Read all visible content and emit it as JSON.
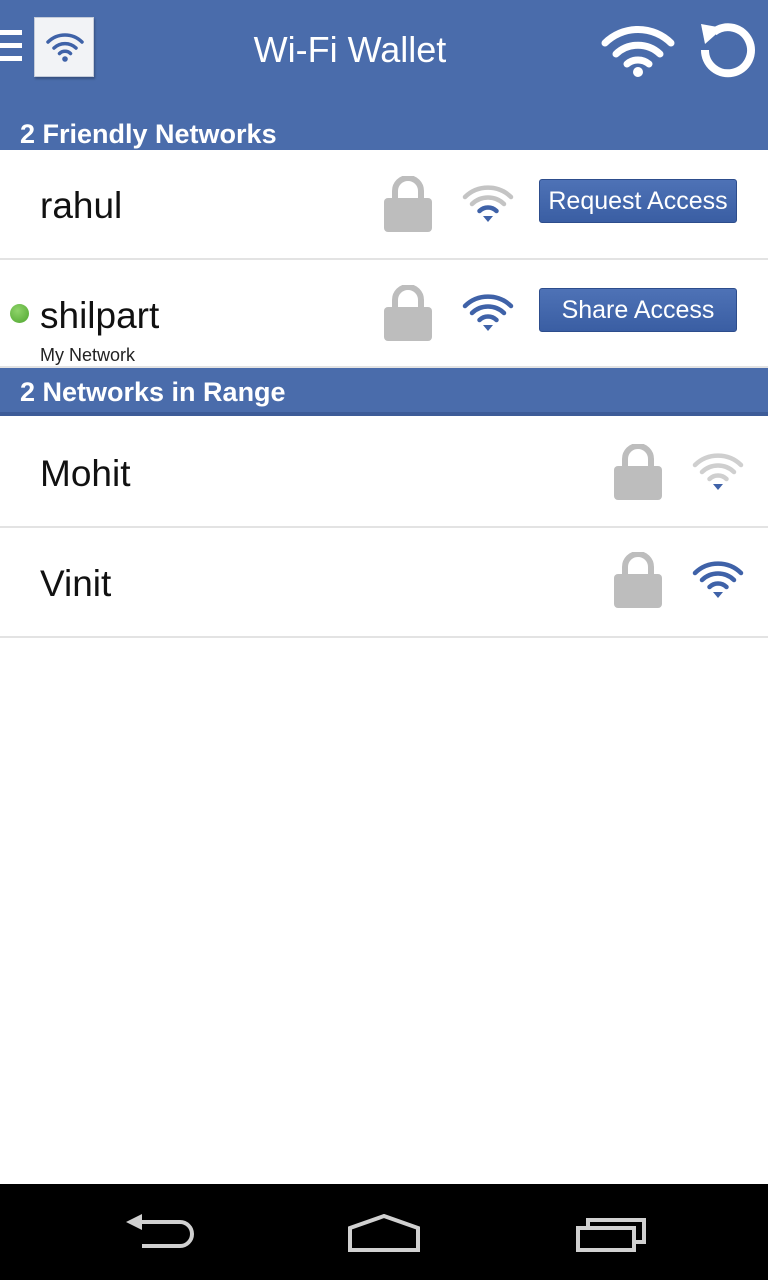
{
  "app": {
    "title": "Wi-Fi Wallet"
  },
  "toolbar": {
    "menu_icon": "hamburger-icon",
    "app_icon": "wifi-app-icon",
    "wifi_icon": "wifi-icon",
    "refresh_icon": "refresh-icon"
  },
  "friendly": {
    "header": "2 Friendly Networks",
    "items": [
      {
        "name": "rahul",
        "subtitle": "",
        "locked": true,
        "signal": "weak",
        "action": "Request Access",
        "connected": false
      },
      {
        "name": "shilpart",
        "subtitle": "My Network",
        "locked": true,
        "signal": "strong",
        "action": "Share Access",
        "connected": true
      }
    ]
  },
  "in_range": {
    "header": "2 Networks in Range",
    "items": [
      {
        "name": "Mohit",
        "locked": true,
        "signal": "weak"
      },
      {
        "name": "Vinit",
        "locked": true,
        "signal": "strong"
      }
    ]
  },
  "navbar": {
    "back_icon": "back-icon",
    "home_icon": "home-icon",
    "recents_icon": "recents-icon"
  },
  "colors": {
    "header_blue": "#4a6cab",
    "signal_strong": "#3f62a8",
    "signal_weak": "#bdbdbd",
    "connected_dot": "#5cb338"
  }
}
